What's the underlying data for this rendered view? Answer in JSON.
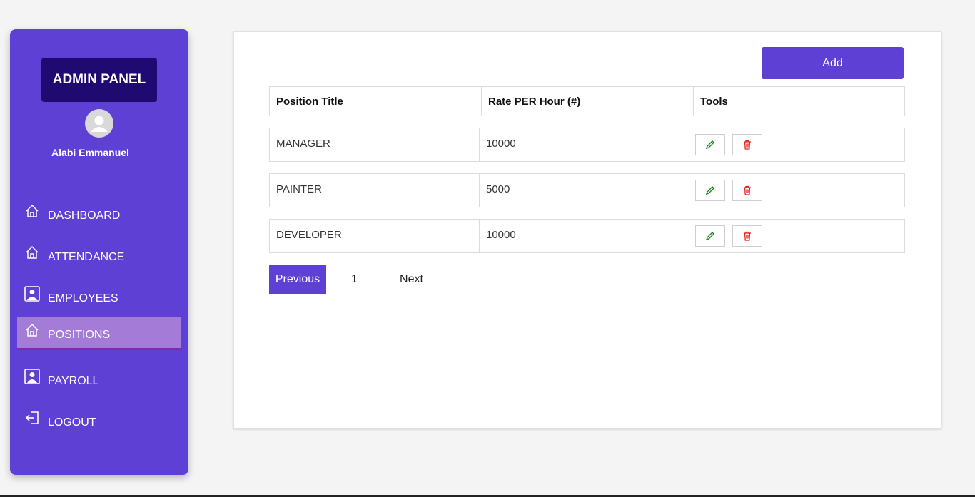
{
  "sidebar": {
    "brand": "ADMIN PANEL",
    "username": "Alabi Emmanuel",
    "items": [
      {
        "label": "DASHBOARD",
        "icon": "home-icon"
      },
      {
        "label": "ATTENDANCE",
        "icon": "home-icon"
      },
      {
        "label": "EMPLOYEES",
        "icon": "person-icon"
      },
      {
        "label": "POSITIONS",
        "icon": "home-icon",
        "active": true
      },
      {
        "label": "PAYROLL",
        "icon": "person-icon"
      },
      {
        "label": "LOGOUT",
        "icon": "logout-icon"
      }
    ]
  },
  "main": {
    "add_label": "Add",
    "table": {
      "headers": [
        "Position Title",
        "Rate PER Hour (#)",
        "Tools"
      ],
      "rows": [
        {
          "title": "MANAGER",
          "rate": "10000"
        },
        {
          "title": "PAINTER",
          "rate": "5000"
        },
        {
          "title": "DEVELOPER",
          "rate": "10000"
        }
      ]
    },
    "pagination": {
      "previous": "Previous",
      "page": "1",
      "next": "Next"
    }
  },
  "colors": {
    "accent": "#5e40d4",
    "brand_bg": "#1f0a72",
    "active_item": "#a57bd8",
    "edit_icon": "#1a8a1a",
    "delete_icon": "#e02020"
  }
}
